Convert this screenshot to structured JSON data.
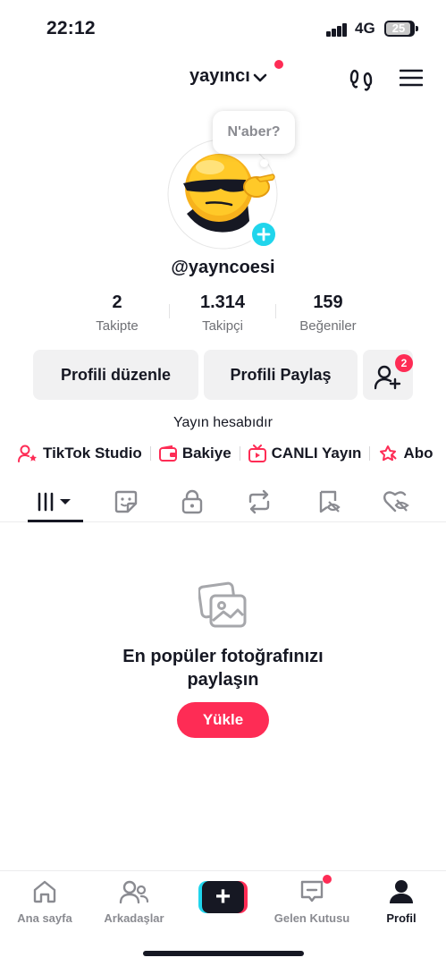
{
  "status_bar": {
    "time": "22:12",
    "network": "4G",
    "battery": "25"
  },
  "header": {
    "account_name": "yayıncı"
  },
  "profile": {
    "bubble_text": "N'aber?",
    "username": "@yayncoesi",
    "bio": "Yayın hesabıdır"
  },
  "stats": [
    {
      "value": "2",
      "label": "Takipte"
    },
    {
      "value": "1.314",
      "label": "Takipçi"
    },
    {
      "value": "159",
      "label": "Beğeniler"
    }
  ],
  "actions": {
    "edit_profile": "Profili düzenle",
    "share_profile": "Profili Paylaş",
    "friend_requests_count": "2"
  },
  "links": [
    {
      "label": "TikTok Studio",
      "icon": "person-star-icon"
    },
    {
      "label": "Bakiye",
      "icon": "wallet-icon"
    },
    {
      "label": "CANLI Yayın",
      "icon": "live-tv-icon"
    },
    {
      "label": "Abo",
      "icon": "subscription-icon"
    }
  ],
  "tabs": [
    {
      "icon": "grid-icon",
      "active": true
    },
    {
      "icon": "sticker-icon"
    },
    {
      "icon": "lock-icon"
    },
    {
      "icon": "repost-icon"
    },
    {
      "icon": "hidden-favorites-icon"
    },
    {
      "icon": "liked-hidden-icon"
    }
  ],
  "empty_state": {
    "title_line1": "En popüler fotoğrafınızı",
    "title_line2": "paylaşın",
    "button": "Yükle"
  },
  "bottom_nav": [
    {
      "label": "Ana sayfa",
      "icon": "home-icon"
    },
    {
      "label": "Arkadaşlar",
      "icon": "friends-icon"
    },
    {
      "label": "",
      "icon": "create-plus-icon"
    },
    {
      "label": "Gelen Kutusu",
      "icon": "inbox-icon"
    },
    {
      "label": "Profil",
      "icon": "profile-icon",
      "active": true
    }
  ],
  "colors": {
    "accent": "#fe2c55",
    "cyan": "#20d5ec",
    "text": "#161823"
  }
}
